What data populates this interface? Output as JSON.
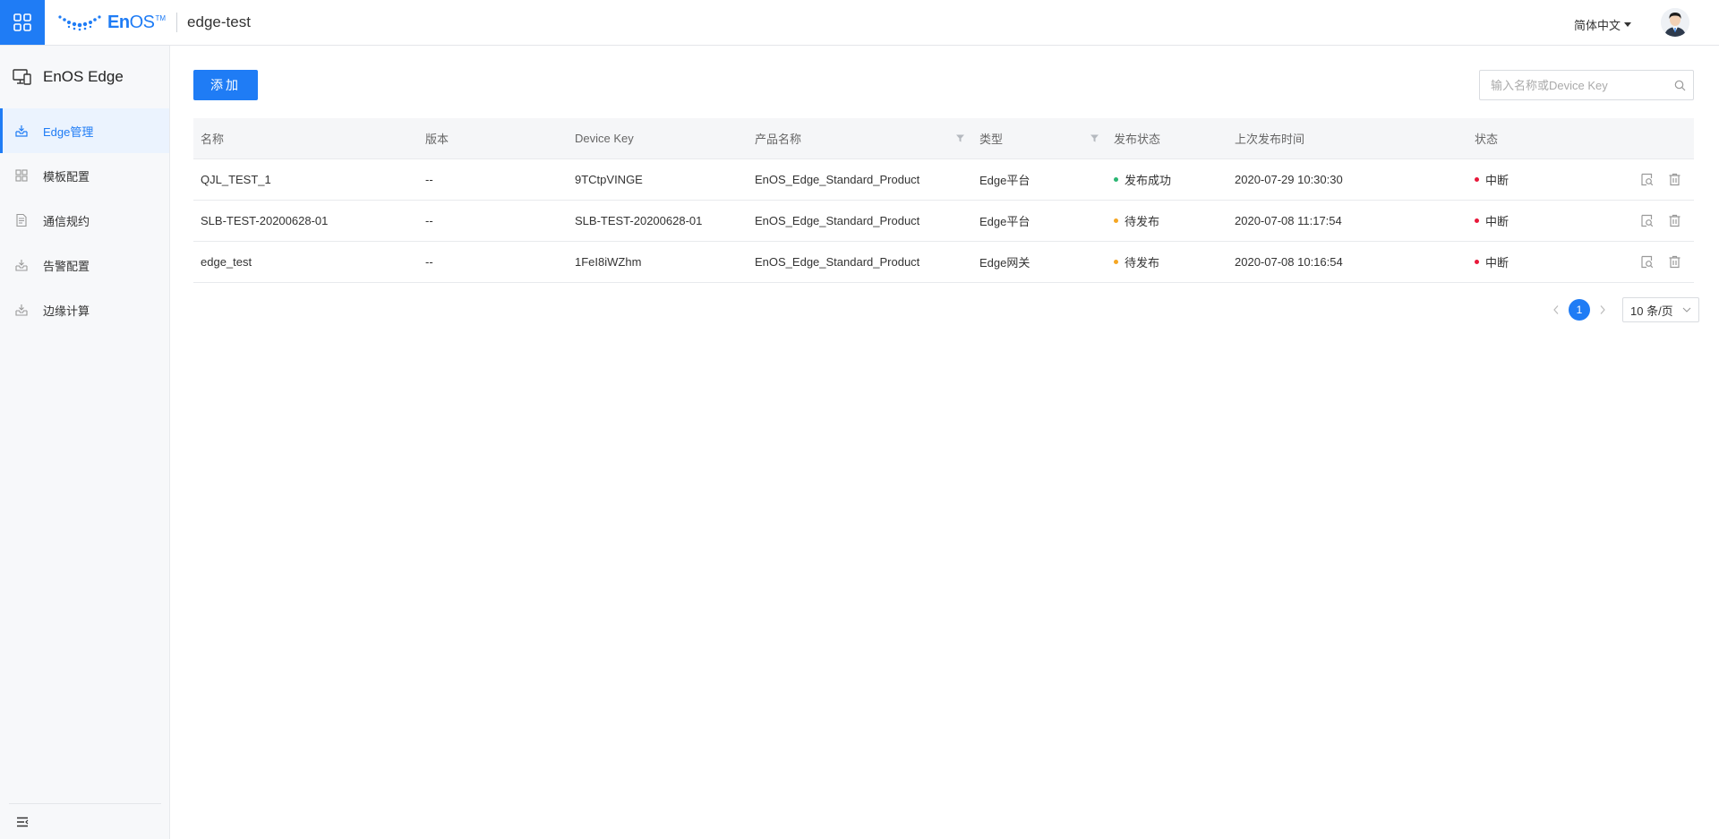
{
  "header": {
    "logo_text_bold": "En",
    "logo_text_regular": "OS",
    "logo_tm": "TM",
    "app_name": "edge-test",
    "language": "简体中文"
  },
  "sidebar": {
    "title": "EnOS Edge",
    "items": [
      {
        "label": "Edge管理",
        "icon": "inbox-icon",
        "active": true
      },
      {
        "label": "模板配置",
        "icon": "grid-icon",
        "active": false
      },
      {
        "label": "通信规约",
        "icon": "document-icon",
        "active": false
      },
      {
        "label": "告警配置",
        "icon": "inbox-icon",
        "active": false
      },
      {
        "label": "边缘计算",
        "icon": "inbox-icon",
        "active": false
      }
    ]
  },
  "toolbar": {
    "add_label": "添加",
    "search_placeholder": "输入名称或Device Key"
  },
  "table": {
    "columns": [
      "名称",
      "版本",
      "Device Key",
      "产品名称",
      "类型",
      "发布状态",
      "上次发布时间",
      "状态"
    ],
    "rows": [
      {
        "name": "QJL_TEST_1",
        "version": "--",
        "device_key": "9TCtpVINGE",
        "product": "EnOS_Edge_Standard_Product",
        "type": "Edge平台",
        "publish_status": "发布成功",
        "publish_color": "#2bb673",
        "last_publish": "2020-07-29 10:30:30",
        "status": "中断",
        "status_color": "#e8183a"
      },
      {
        "name": "SLB-TEST-20200628-01",
        "version": "--",
        "device_key": "SLB-TEST-20200628-01",
        "product": "EnOS_Edge_Standard_Product",
        "type": "Edge平台",
        "publish_status": "待发布",
        "publish_color": "#f5a623",
        "last_publish": "2020-07-08 11:17:54",
        "status": "中断",
        "status_color": "#e8183a"
      },
      {
        "name": "edge_test",
        "version": "--",
        "device_key": "1FeI8iWZhm",
        "product": "EnOS_Edge_Standard_Product",
        "type": "Edge网关",
        "publish_status": "待发布",
        "publish_color": "#f5a623",
        "last_publish": "2020-07-08 10:16:54",
        "status": "中断",
        "status_color": "#e8183a"
      }
    ]
  },
  "pagination": {
    "current_page": "1",
    "page_size": "10 条/页"
  },
  "colors": {
    "accent": "#1f7cf5"
  }
}
